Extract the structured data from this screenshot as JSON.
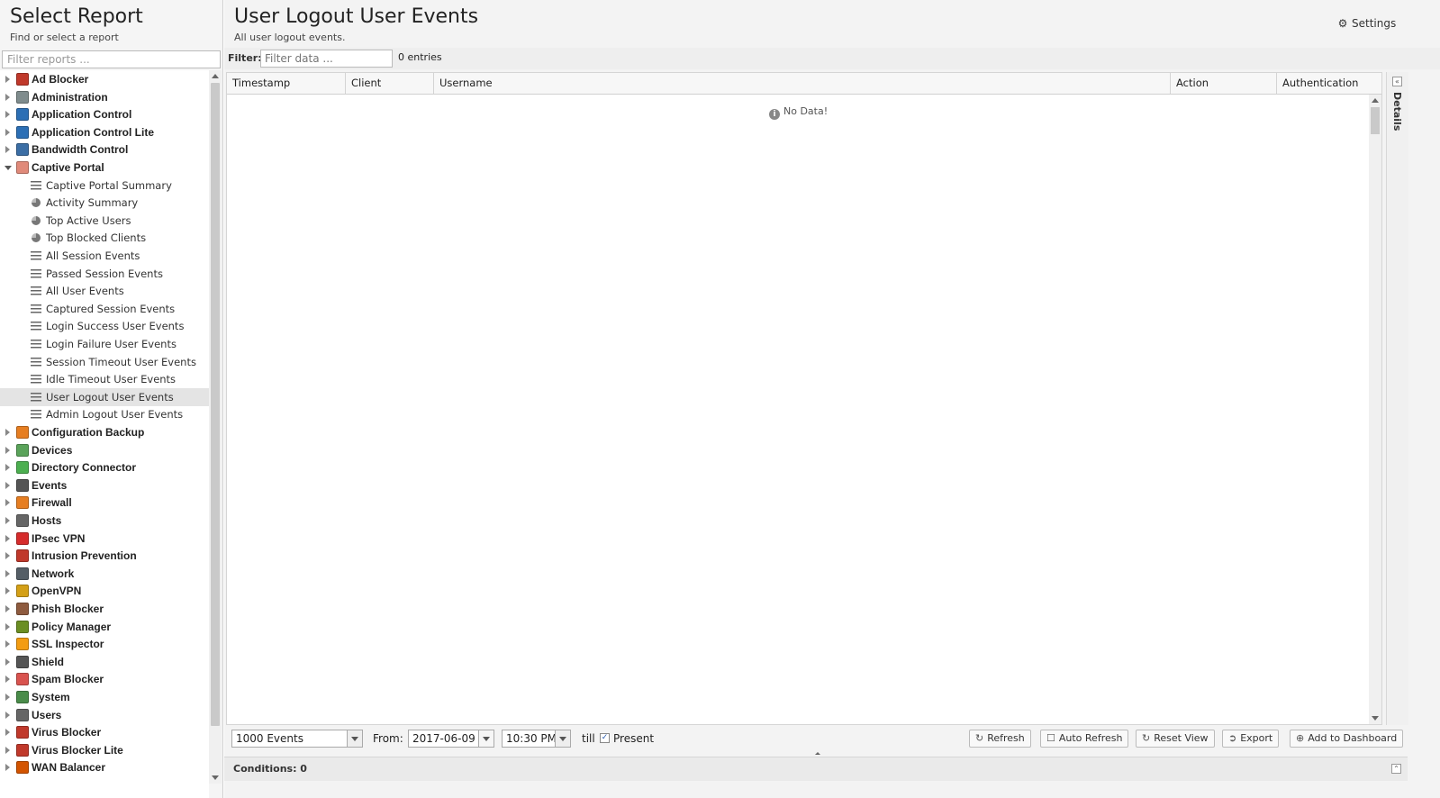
{
  "left": {
    "title": "Select Report",
    "subtitle": "Find or select a report",
    "filter_placeholder": "Filter reports ..."
  },
  "tree": [
    {
      "label": "Ad Blocker",
      "icon": "ad-blocker-icon",
      "color": "#c0392b",
      "expanded": false
    },
    {
      "label": "Administration",
      "icon": "administration-icon",
      "color": "#7f8c8d",
      "expanded": false
    },
    {
      "label": "Application Control",
      "icon": "application-control-icon",
      "color": "#2c6fb5",
      "expanded": false
    },
    {
      "label": "Application Control Lite",
      "icon": "application-control-lite-icon",
      "color": "#2c6fb5",
      "expanded": false
    },
    {
      "label": "Bandwidth Control",
      "icon": "bandwidth-control-icon",
      "color": "#3b6ea5",
      "expanded": false
    },
    {
      "label": "Captive Portal",
      "icon": "captive-portal-icon",
      "color": "#e08a7a",
      "expanded": true,
      "children": [
        {
          "label": "Captive Portal Summary",
          "type": "text"
        },
        {
          "label": "Activity Summary",
          "type": "pie"
        },
        {
          "label": "Top Active Users",
          "type": "pie"
        },
        {
          "label": "Top Blocked Clients",
          "type": "pie"
        },
        {
          "label": "All Session Events",
          "type": "list"
        },
        {
          "label": "Passed Session Events",
          "type": "list"
        },
        {
          "label": "All User Events",
          "type": "list"
        },
        {
          "label": "Captured Session Events",
          "type": "list"
        },
        {
          "label": "Login Success User Events",
          "type": "list"
        },
        {
          "label": "Login Failure User Events",
          "type": "list"
        },
        {
          "label": "Session Timeout User Events",
          "type": "list"
        },
        {
          "label": "Idle Timeout User Events",
          "type": "list"
        },
        {
          "label": "User Logout User Events",
          "type": "list",
          "selected": true
        },
        {
          "label": "Admin Logout User Events",
          "type": "list"
        }
      ]
    },
    {
      "label": "Configuration Backup",
      "icon": "configuration-backup-icon",
      "color": "#e67e22",
      "expanded": false
    },
    {
      "label": "Devices",
      "icon": "devices-icon",
      "color": "#5aa35a",
      "expanded": false
    },
    {
      "label": "Directory Connector",
      "icon": "directory-connector-icon",
      "color": "#4caf50",
      "expanded": false
    },
    {
      "label": "Events",
      "icon": "events-icon",
      "color": "#555555",
      "expanded": false
    },
    {
      "label": "Firewall",
      "icon": "firewall-icon",
      "color": "#e67e22",
      "expanded": false
    },
    {
      "label": "Hosts",
      "icon": "hosts-icon",
      "color": "#666666",
      "expanded": false
    },
    {
      "label": "IPsec VPN",
      "icon": "ipsec-vpn-icon",
      "color": "#d62c2c",
      "expanded": false
    },
    {
      "label": "Intrusion Prevention",
      "icon": "intrusion-prevention-icon",
      "color": "#c0392b",
      "expanded": false
    },
    {
      "label": "Network",
      "icon": "network-icon",
      "color": "#555e66",
      "expanded": false
    },
    {
      "label": "OpenVPN",
      "icon": "openvpn-icon",
      "color": "#d4a017",
      "expanded": false
    },
    {
      "label": "Phish Blocker",
      "icon": "phish-blocker-icon",
      "color": "#8e5b3f",
      "expanded": false
    },
    {
      "label": "Policy Manager",
      "icon": "policy-manager-icon",
      "color": "#6b8e23",
      "expanded": false
    },
    {
      "label": "SSL Inspector",
      "icon": "ssl-inspector-icon",
      "color": "#f39c12",
      "expanded": false
    },
    {
      "label": "Shield",
      "icon": "shield-icon",
      "color": "#555555",
      "expanded": false
    },
    {
      "label": "Spam Blocker",
      "icon": "spam-blocker-icon",
      "color": "#d9534f",
      "expanded": false
    },
    {
      "label": "System",
      "icon": "system-icon",
      "color": "#4a8c4a",
      "expanded": false
    },
    {
      "label": "Users",
      "icon": "users-icon",
      "color": "#666666",
      "expanded": false
    },
    {
      "label": "Virus Blocker",
      "icon": "virus-blocker-icon",
      "color": "#c0392b",
      "expanded": false
    },
    {
      "label": "Virus Blocker Lite",
      "icon": "virus-blocker-lite-icon",
      "color": "#c0392b",
      "expanded": false
    },
    {
      "label": "WAN Balancer",
      "icon": "wan-balancer-icon",
      "color": "#d35400",
      "expanded": false
    }
  ],
  "main": {
    "title": "User Logout User Events",
    "subtitle": "All user logout events.",
    "settings_label": "Settings",
    "filter_label": "Filter:",
    "filter_placeholder": "Filter data ...",
    "entries": "0 entries",
    "columns": [
      "Timestamp",
      "Client",
      "Username",
      "Action",
      "Authentication"
    ],
    "no_data": "No Data!",
    "details_label": "Details"
  },
  "toolbar": {
    "events_select": "1000 Events",
    "from_label": "From:",
    "from_date": "2017-06-09",
    "from_time": "10:30 PM",
    "till_label": "till",
    "present_checked": true,
    "present_label": "Present",
    "refresh": "Refresh",
    "auto_refresh": "Auto Refresh",
    "reset_view": "Reset View",
    "export": "Export",
    "add_to_dashboard": "Add to Dashboard"
  },
  "conditions": {
    "label": "Conditions: 0"
  }
}
